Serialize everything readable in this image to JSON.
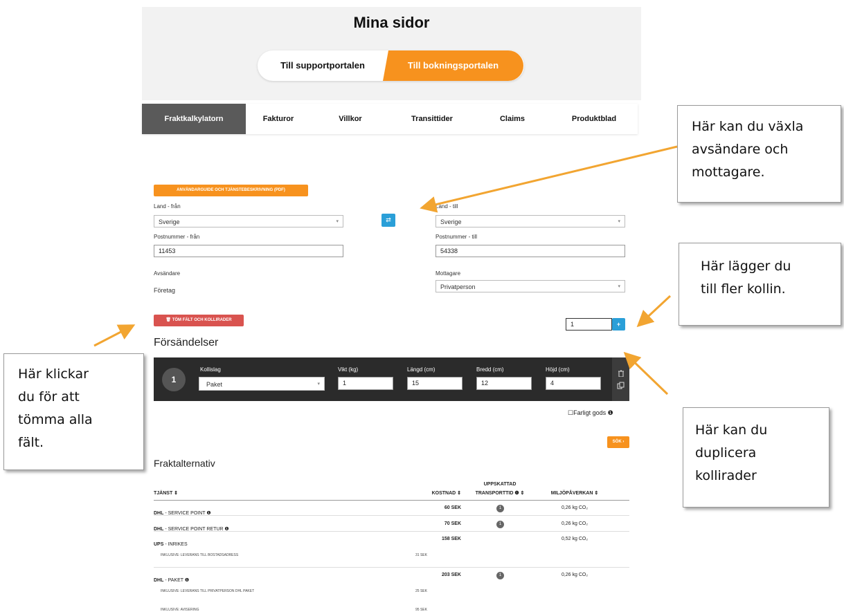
{
  "header": {
    "title": "Mina sidor",
    "support_button": "Till supportportalen",
    "booking_button": "Till bokningsportalen"
  },
  "tabs": [
    {
      "label": "Fraktkalkylatorn",
      "active": true
    },
    {
      "label": "Fakturor"
    },
    {
      "label": "Villkor"
    },
    {
      "label": "Transittider"
    },
    {
      "label": "Claims"
    },
    {
      "label": "Produktblad"
    }
  ],
  "form": {
    "guide_button": "ANVÄNDARGUIDE OCH TJÄNSTEBESKRIVNING (PDF)",
    "country_from_label": "Land - från",
    "country_from_value": "Sverige",
    "country_to_label": "Land - till",
    "country_to_value": "Sverige",
    "swap_icon": "⇄",
    "postal_from_label": "Postnummer - från",
    "postal_from_value": "11453",
    "postal_to_label": "Postnummer - till",
    "postal_to_value": "54338",
    "sender_label": "Avsändare",
    "sender_value": "Företag",
    "receiver_label": "Mottagare",
    "receiver_value": "Privatperson",
    "clear_button": "🗑 TÖM FÄLT OCH KOLLIRADER",
    "package_count": "1",
    "add_icon": "+"
  },
  "shipments": {
    "heading": "Försändelser",
    "row_number": "1",
    "type_label": "Kollislag",
    "type_value": "Paket",
    "weight_label": "Vikt (kg)",
    "weight_value": "1",
    "length_label": "Längd (cm)",
    "length_value": "15",
    "width_label": "Bredd (cm)",
    "width_value": "12",
    "height_label": "Höjd (cm)",
    "height_value": "4",
    "dangerous_goods": "☐Farligt gods ❶",
    "search_button": "SÖK ›"
  },
  "results": {
    "heading": "Fraktalternativ",
    "col_service": "TJÄNST ⇕",
    "col_cost": "KOSTNAD ⇕",
    "col_transit_line1": "UPPSKATTAD",
    "col_transit_line2": "TRANSPORTTID ❶ ⇕",
    "col_env": "MILJÖPÅVERKAN ⇕",
    "rows": [
      {
        "carrier": "DHL",
        "service": " - SERVICE POINT ❶",
        "cost": "60 SEK",
        "transit": "1",
        "env": "0,26 kg CO₂"
      },
      {
        "carrier": "DHL",
        "service": " - SERVICE POINT RETUR ❶",
        "cost": "70 SEK",
        "transit": "1",
        "env": "0,26 kg CO₂"
      },
      {
        "carrier": "UPS",
        "service": " - INRIKES",
        "cost": "158 SEK",
        "env": "0,52 kg CO₂",
        "sub": "INKLUSIVE: LEVERANS TILL BOSTADSADRESS",
        "sub_cost": "31 SEK"
      },
      {
        "carrier": "DHL",
        "service": " - PAKET ❶",
        "cost": "203 SEK",
        "transit": "1",
        "env": "0,26 kg CO₂",
        "sub": "INKLUSIVE: LEVERANS TILL PRIVATPERSON DHL PAKET",
        "sub_cost": "25 SEK",
        "sub2": "INKLUSIVE: AVISERING",
        "sub2_cost": "95 SEK"
      }
    ]
  },
  "callouts": {
    "swap": [
      "Här kan du växla",
      "avsändare och",
      "mottagare."
    ],
    "add": [
      "Här lägger du",
      "till fler kollin."
    ],
    "clear": [
      "Här klickar",
      "du för att",
      "tömma alla",
      "fält."
    ],
    "duplicate": [
      "Här kan du",
      "duplicera",
      "kollirader"
    ]
  },
  "colors": {
    "orange": "#f7921e",
    "red": "#d9534f",
    "blue": "#2a9fd8",
    "arrow": "#f2a531"
  }
}
